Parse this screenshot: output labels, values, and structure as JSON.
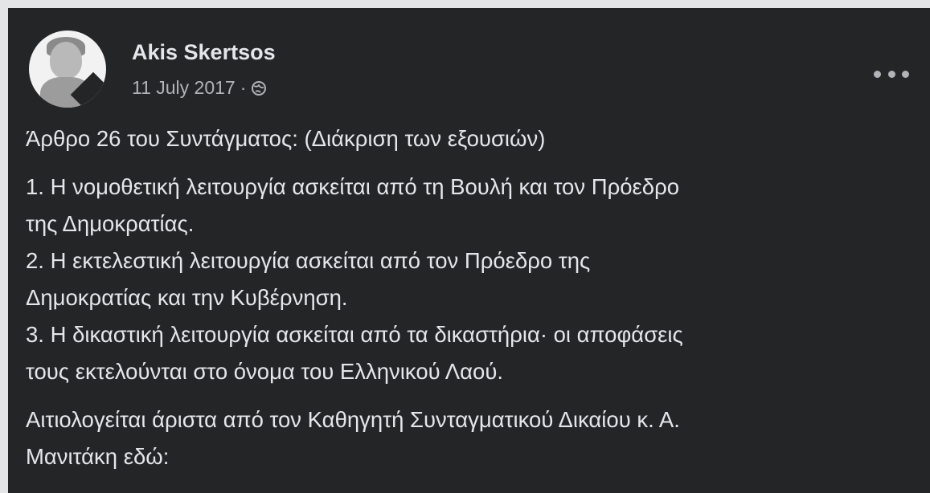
{
  "post": {
    "author": "Akis Skertsos",
    "date": "11 July 2017",
    "separator": "·",
    "privacy_icon": "globe-icon",
    "more_icon": "more-options-icon",
    "paragraphs": {
      "title": "Άρθρο 26 του Συντάγματος: (Διάκριση των εξουσιών)",
      "p1_line1": "1. Η νομοθετική λειτουργία ασκείται από τη Βουλή και τον Πρόεδρο",
      "p1_line2": "της Δημοκρατίας.",
      "p2_line1": "2. Η εκτελεστική λειτουργία ασκείται από τον Πρόεδρο της",
      "p2_line2": "Δημοκρατίας και την Κυβέρνηση.",
      "p3_line1": "3. Η δικαστική λειτουργία ασκείται από τα δικαστήρια· οι αποφάσεις",
      "p3_line2": "τους εκτελούνται στο όνομα του Ελληνικού Λαού.",
      "p4_line1": "Αιτιολογείται άριστα από τον Καθηγητή Συνταγματικού Δικαίου κ. Α.",
      "p4_line2": "Μανιτάκη εδώ:"
    }
  },
  "colors": {
    "card_background": "#242526",
    "page_background": "#e4e5e7",
    "primary_text": "#e4e6eb",
    "secondary_text": "#b0b3b8"
  }
}
